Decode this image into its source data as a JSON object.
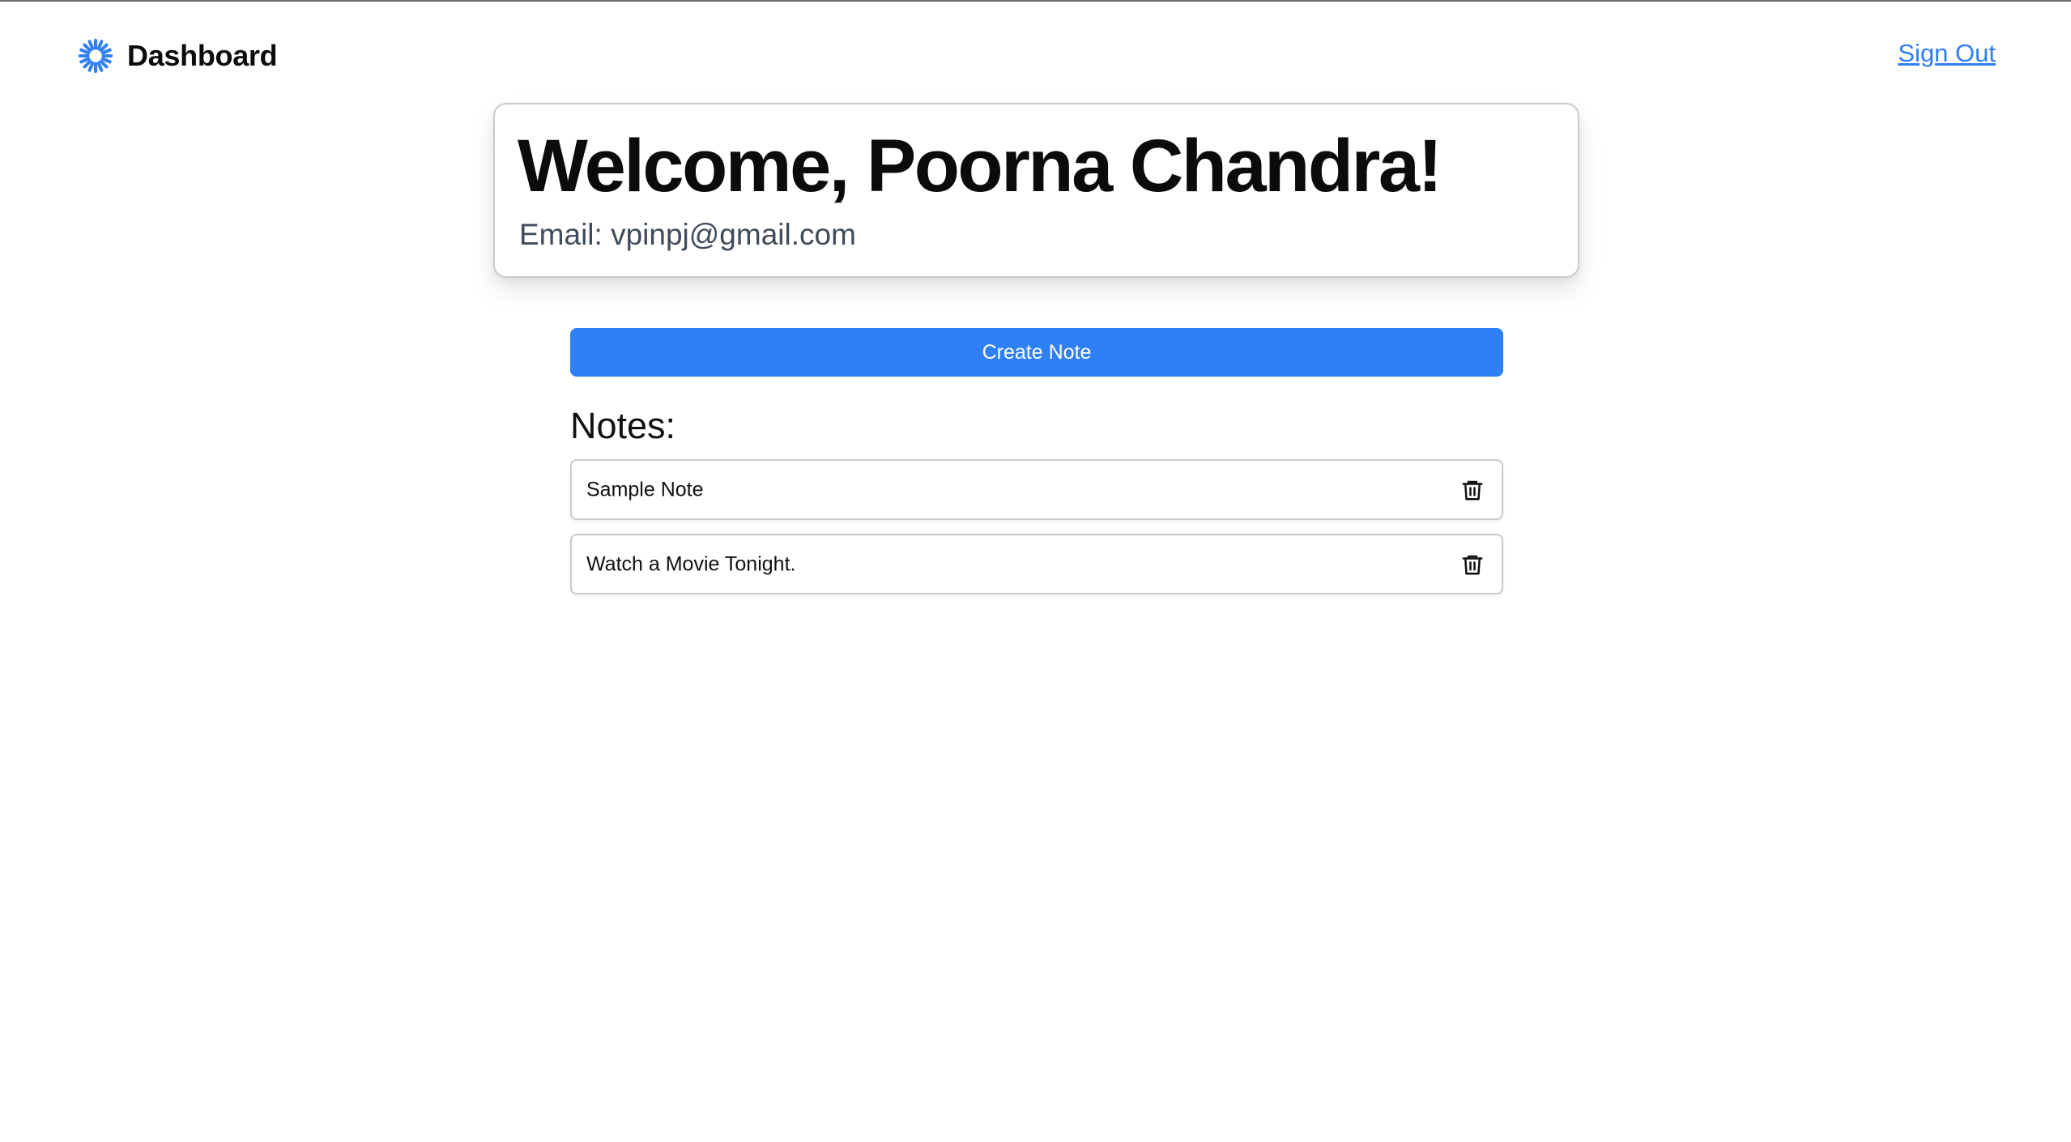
{
  "header": {
    "title": "Dashboard",
    "logo_icon": "spinner-sun-icon",
    "sign_out_label": "Sign Out"
  },
  "welcome": {
    "title": "Welcome, Poorna Chandra!",
    "email_label": "Email: ",
    "email_value": "vpinpj@gmail.com"
  },
  "actions": {
    "create_label": "Create Note"
  },
  "notes": {
    "heading": "Notes:",
    "items": [
      {
        "text": "Sample Note",
        "icon": "trash-icon"
      },
      {
        "text": "Watch a Movie Tonight.",
        "icon": "trash-icon"
      }
    ]
  },
  "colors": {
    "accent": "#2f7ff6",
    "link": "#2f7df6",
    "text": "#111111",
    "muted": "#3f4a5a",
    "border": "#c7c9ce"
  }
}
